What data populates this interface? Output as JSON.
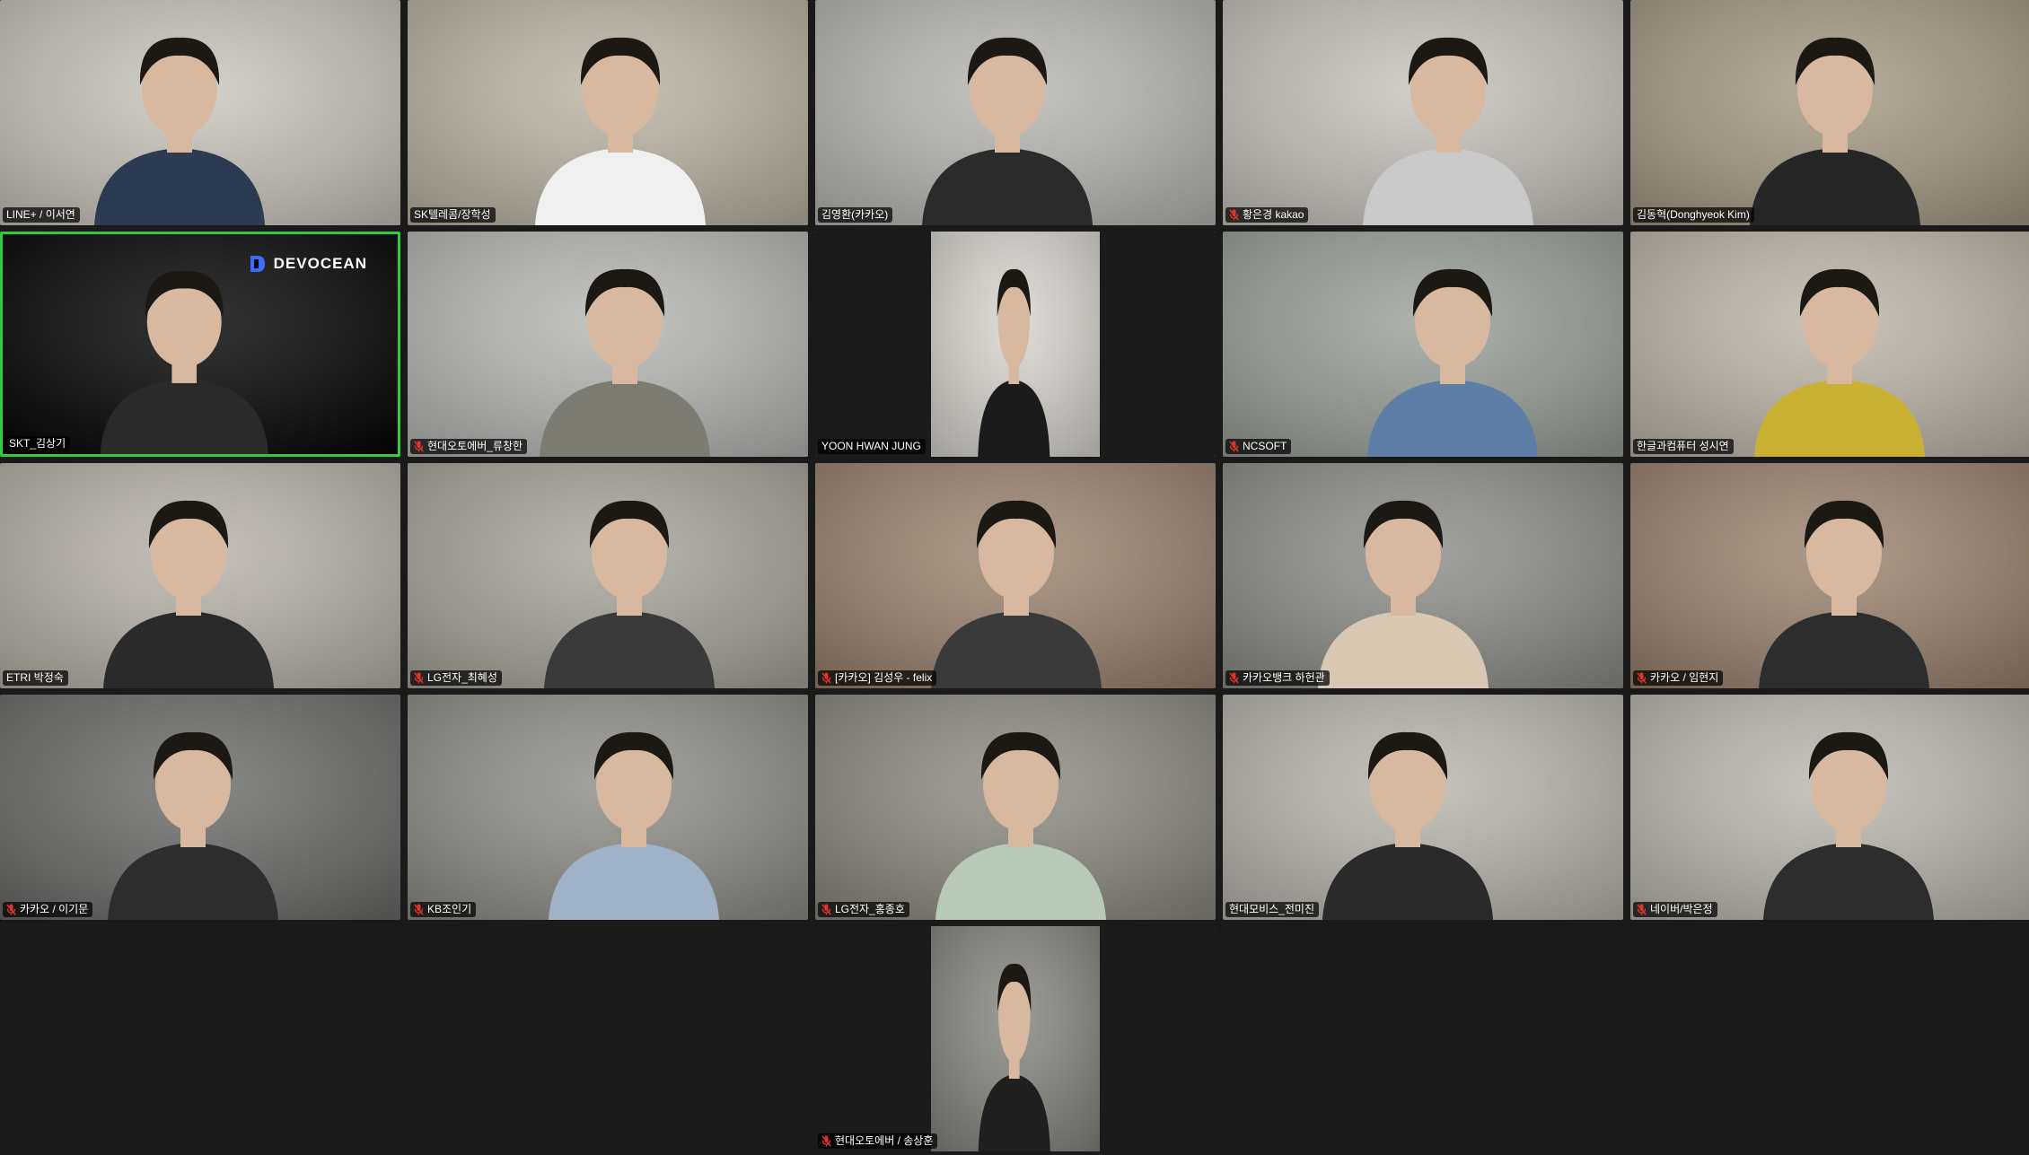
{
  "meeting": {
    "participants": [
      {
        "name": "LINE+ / 이서연",
        "muted": false,
        "bg": "#c9c5bd"
      },
      {
        "name": "SK텔레콤/장학성",
        "muted": false,
        "bg": "#bcb3a4"
      },
      {
        "name": "김영환(카카오)",
        "muted": false,
        "bg": "#b8b7b2"
      },
      {
        "name": "황은경 kakao",
        "muted": true,
        "bg": "#c7c2bc"
      },
      {
        "name": "김동혁(Donghyeok Kim)",
        "muted": false,
        "bg": "#a79a86"
      },
      {
        "name": "SKT_김상기",
        "muted": false,
        "bg": "#050505",
        "active": true,
        "logo": "DEVOCEAN"
      },
      {
        "name": "현대오토에버_류창한",
        "muted": true,
        "bg": "#b7b8b4"
      },
      {
        "name": "YOON HWAN JUNG",
        "muted": false,
        "bg": "#d9d6d0",
        "portrait": true
      },
      {
        "name": "NCSOFT",
        "muted": true,
        "bg": "#9aa09a"
      },
      {
        "name": "한글과컴퓨터 성시연",
        "muted": false,
        "bg": "#bfb6aa"
      },
      {
        "name": "ETRI 박정숙",
        "muted": false,
        "bg": "#b8b3aa"
      },
      {
        "name": "LG전자_최혜성",
        "muted": true,
        "bg": "#a8a49c"
      },
      {
        "name": "[카카오] 김성우 - felix",
        "muted": true,
        "bg": "#9a8370"
      },
      {
        "name": "카카오뱅크 하헌관",
        "muted": true,
        "bg": "#8d8e88"
      },
      {
        "name": "카카오 / 임현지",
        "muted": true,
        "bg": "#9a8370"
      },
      {
        "name": "카카오 / 이기문",
        "muted": true,
        "bg": "#6c6c6a"
      },
      {
        "name": "KB조인기",
        "muted": true,
        "bg": "#8f8e88"
      },
      {
        "name": "LG전자_홍종호",
        "muted": true,
        "bg": "#8c8a80"
      },
      {
        "name": "현대모비스_전미진",
        "muted": false,
        "bg": "#b9b6ae"
      },
      {
        "name": "네이버/박은정",
        "muted": true,
        "bg": "#bcb8b0"
      },
      {
        "name": "현대오토에버 / 송상훈",
        "muted": true,
        "bg": "#86857f",
        "portrait": true
      }
    ]
  },
  "icons": {
    "mute": "microphone-muted-icon",
    "logo": "devocean-logo-icon"
  },
  "colors": {
    "active_speaker": "#2ecc40",
    "mute_red": "#e0332b",
    "background": "#1a1a1a"
  }
}
